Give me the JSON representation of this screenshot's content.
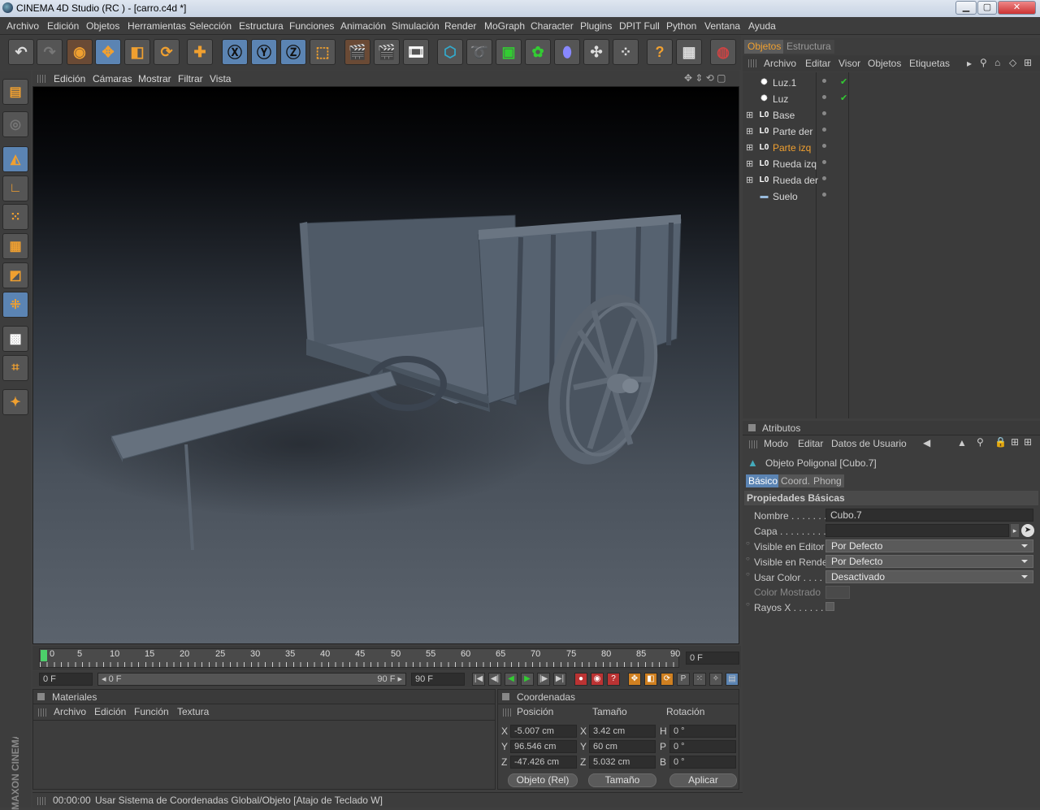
{
  "window": {
    "title": "CINEMA 4D Studio (RC ) - [carro.c4d *]",
    "minimize": "▁",
    "maximize": "▢",
    "close": "✕"
  },
  "menubar": [
    "Archivo",
    "Edición",
    "Objetos",
    "Herramientas",
    "Selección",
    "Estructura",
    "Funciones",
    "Animación",
    "Simulación",
    "Render",
    "MoGraph",
    "Character",
    "Plugins",
    "DPIT Full",
    "Python",
    "Ventana",
    "Ayuda"
  ],
  "viewport": {
    "menu": [
      "Edición",
      "Cámaras",
      "Mostrar",
      "Filtrar",
      "Vista"
    ],
    "nav_icons": "✥ ⇕ ⟲ ▢"
  },
  "timeline": {
    "ticks": [
      "0",
      "5",
      "10",
      "15",
      "20",
      "25",
      "30",
      "35",
      "40",
      "45",
      "50",
      "55",
      "60",
      "65",
      "70",
      "75",
      "80",
      "85",
      "90"
    ],
    "current_frame": "0 F",
    "start": "0 F",
    "range_start": "◂ 0 F",
    "range_end": "90 F ▸",
    "end": "90 F"
  },
  "materials": {
    "title": "Materiales",
    "menu": [
      "Archivo",
      "Edición",
      "Función",
      "Textura"
    ]
  },
  "coordinates": {
    "title": "Coordenadas",
    "headers": [
      "Posición",
      "Tamaño",
      "Rotación"
    ],
    "rows": [
      {
        "axis": "X",
        "pos": "-5.007 cm",
        "size_axis": "X",
        "size": "3.42 cm",
        "rot_axis": "H",
        "rot": "0 °"
      },
      {
        "axis": "Y",
        "pos": "96.546 cm",
        "size_axis": "Y",
        "size": "60 cm",
        "rot_axis": "P",
        "rot": "0 °"
      },
      {
        "axis": "Z",
        "pos": "-47.426 cm",
        "size_axis": "Z",
        "size": "5.032 cm",
        "rot_axis": "B",
        "rot": "0 °"
      }
    ],
    "mode": "Objeto (Rel)",
    "size_mode": "Tamaño",
    "apply": "Aplicar"
  },
  "status": {
    "time": "00:00:00",
    "message": "Usar Sistema de Coordenadas Global/Objeto [Atajo de Teclado W]"
  },
  "objects": {
    "tabs": [
      "Objetos",
      "Estructura"
    ],
    "menu": [
      "Archivo",
      "Editar",
      "Visor",
      "Objetos",
      "Etiquetas"
    ],
    "items": [
      {
        "name": "Luz.1",
        "icon": "✺",
        "check": "✔"
      },
      {
        "name": "Luz",
        "icon": "✺",
        "check": "✔"
      },
      {
        "name": "Base",
        "icon": "L0",
        "check": ""
      },
      {
        "name": "Parte der",
        "icon": "L0",
        "check": ""
      },
      {
        "name": "Parte izq",
        "icon": "L0",
        "check": ""
      },
      {
        "name": "Rueda izq",
        "icon": "L0",
        "check": ""
      },
      {
        "name": "Rueda der",
        "icon": "L0",
        "check": ""
      },
      {
        "name": "Suelo",
        "icon": "▬",
        "check": ""
      }
    ]
  },
  "attributes": {
    "title": "Atributos",
    "menu": [
      "Modo",
      "Editar",
      "Datos de Usuario"
    ],
    "object_label": "Objeto Poligonal [Cubo.7]",
    "tabs": [
      "Básico",
      "Coord.",
      "Phong"
    ],
    "section": "Propiedades Básicas",
    "fields": {
      "nombre_label": "Nombre . . . . . . .",
      "nombre": "Cubo.7",
      "capa_label": "Capa . . . . . . . . .",
      "visible_editor_label": "Visible en Editor",
      "visible_editor": "Por Defecto",
      "visible_render_label": "Visible en Render",
      "visible_render": "Por Defecto",
      "usar_color_label": "Usar Color . . . . .",
      "usar_color": "Desactivado",
      "color_mostrado_label": "Color Mostrado",
      "rayos_x_label": "Rayos X . . . . . . ."
    }
  },
  "branding": "MAXON CINEMA 4D",
  "colors": {
    "accent": "#f0a030",
    "selection": "#5b84b3",
    "bg": "#3d3d3d"
  }
}
